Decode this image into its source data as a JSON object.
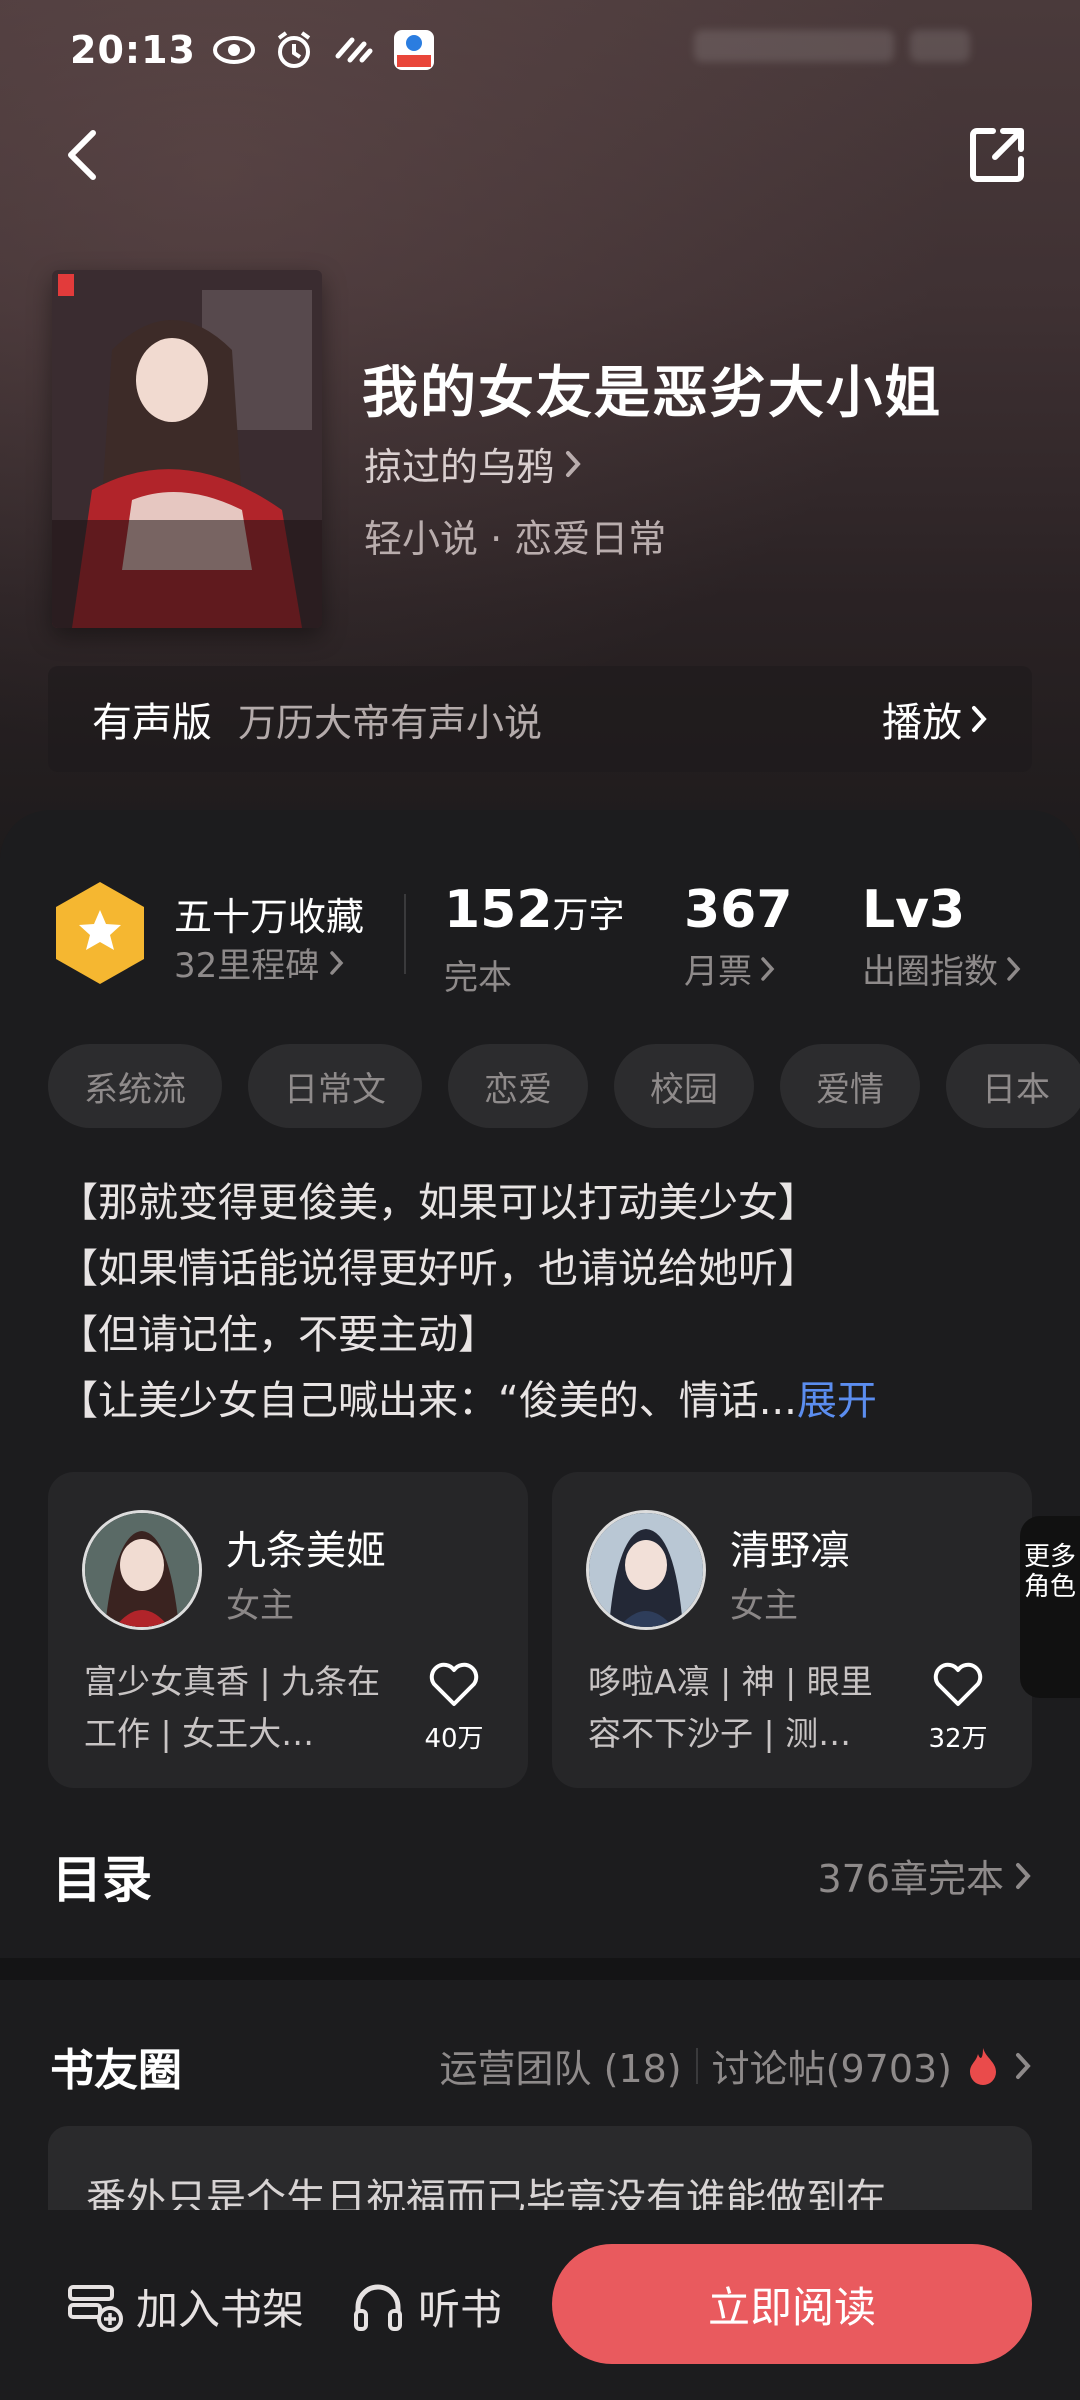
{
  "status_bar": {
    "time": "20:13",
    "icons": [
      "eye-icon",
      "alarm-icon",
      "signal-icon",
      "app-icon"
    ]
  },
  "header": {
    "back_icon": "chevron-left-icon",
    "share_icon": "share-icon"
  },
  "book": {
    "title": "我的女友是恶劣大小姐",
    "author": "掠过的乌鸦",
    "genre": "轻小说 · 恋爱日常",
    "cover_alt": "book-cover"
  },
  "audio": {
    "label": "有声版",
    "description": "万历大帝有声小说",
    "play": "播放"
  },
  "stats": {
    "collect_title": "五十万收藏",
    "collect_sub": "32里程碑",
    "words_num": "152",
    "words_unit": "万字",
    "words_sub": "完本",
    "tickets_num": "367",
    "tickets_sub": "月票",
    "level_num": "Lv3",
    "level_sub": "出圈指数"
  },
  "tags": [
    "系统流",
    "日常文",
    "恋爱",
    "校园",
    "爱情",
    "日本"
  ],
  "synopsis": {
    "lines": [
      "【那就变得更俊美，如果可以打动美少女】",
      "【如果情话能说得更好听，也请说给她听】",
      "【但请记住，不要主动】",
      "【让美少女自己喊出来：“俊美的、情话..."
    ],
    "expand": "展开"
  },
  "characters": [
    {
      "name": "九条美姬",
      "role": "女主",
      "desc": "富少女真香 | 九条在工作 | 女王大…",
      "likes": "40万"
    },
    {
      "name": "清野凛",
      "role": "女主",
      "desc": "哆啦A凛 | 神 | 眼里容不下沙子 | 测…",
      "likes": "32万"
    }
  ],
  "more_roles": "更多角色",
  "toc": {
    "title": "目录",
    "info": "376章完本"
  },
  "circle": {
    "title": "书友圈",
    "team": "运营团队 (18)",
    "posts": "讨论帖(9703)"
  },
  "post_preview": "番外只是个生日祝福而已毕竟没有谁能做到在",
  "bottom_bar": {
    "shelf": "加入书架",
    "listen": "听书",
    "read": "立即阅读"
  },
  "colors": {
    "accent": "#e95a5e",
    "link": "#5b8def",
    "badge": "#f5b731"
  }
}
